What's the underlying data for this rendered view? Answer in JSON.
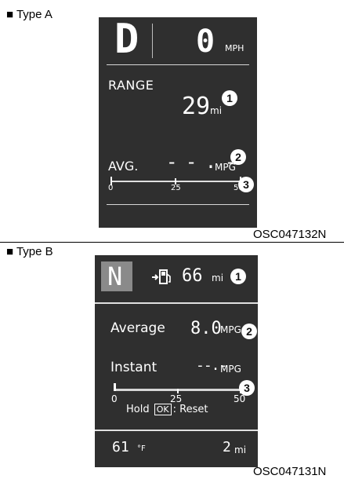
{
  "typeA": {
    "label": "■ Type A",
    "gear": "D",
    "speed": "0",
    "speed_unit": "MPH",
    "range_label": "RANGE",
    "range_value": "29",
    "range_unit": "mi",
    "badge1": "1",
    "avg_label": "AVG.",
    "avg_value": "- - . -",
    "avg_unit": "MPG",
    "badge2": "2",
    "badge3": "3",
    "scale": [
      "0",
      "25",
      "50"
    ],
    "code": "OSC047132N"
  },
  "typeB": {
    "label": "■ Type B",
    "gear": "N",
    "fuel_icon": "fuel-pump-icon",
    "range_value": "66",
    "range_unit": "mi",
    "badge1": "1",
    "average_label": "Average",
    "average_value": "8.0",
    "average_unit": "MPG",
    "badge2": "2",
    "instant_label": "Instant",
    "instant_value": "--.-",
    "instant_unit": "MPG",
    "badge3": "3",
    "scale": [
      "0",
      "25",
      "50"
    ],
    "hold_prefix": "Hold",
    "hold_key": "OK",
    "hold_suffix": ": Reset",
    "temp_value": "61",
    "temp_unit": "°F",
    "trip_value": "2",
    "trip_unit": "mi",
    "code": "OSC047131N"
  }
}
